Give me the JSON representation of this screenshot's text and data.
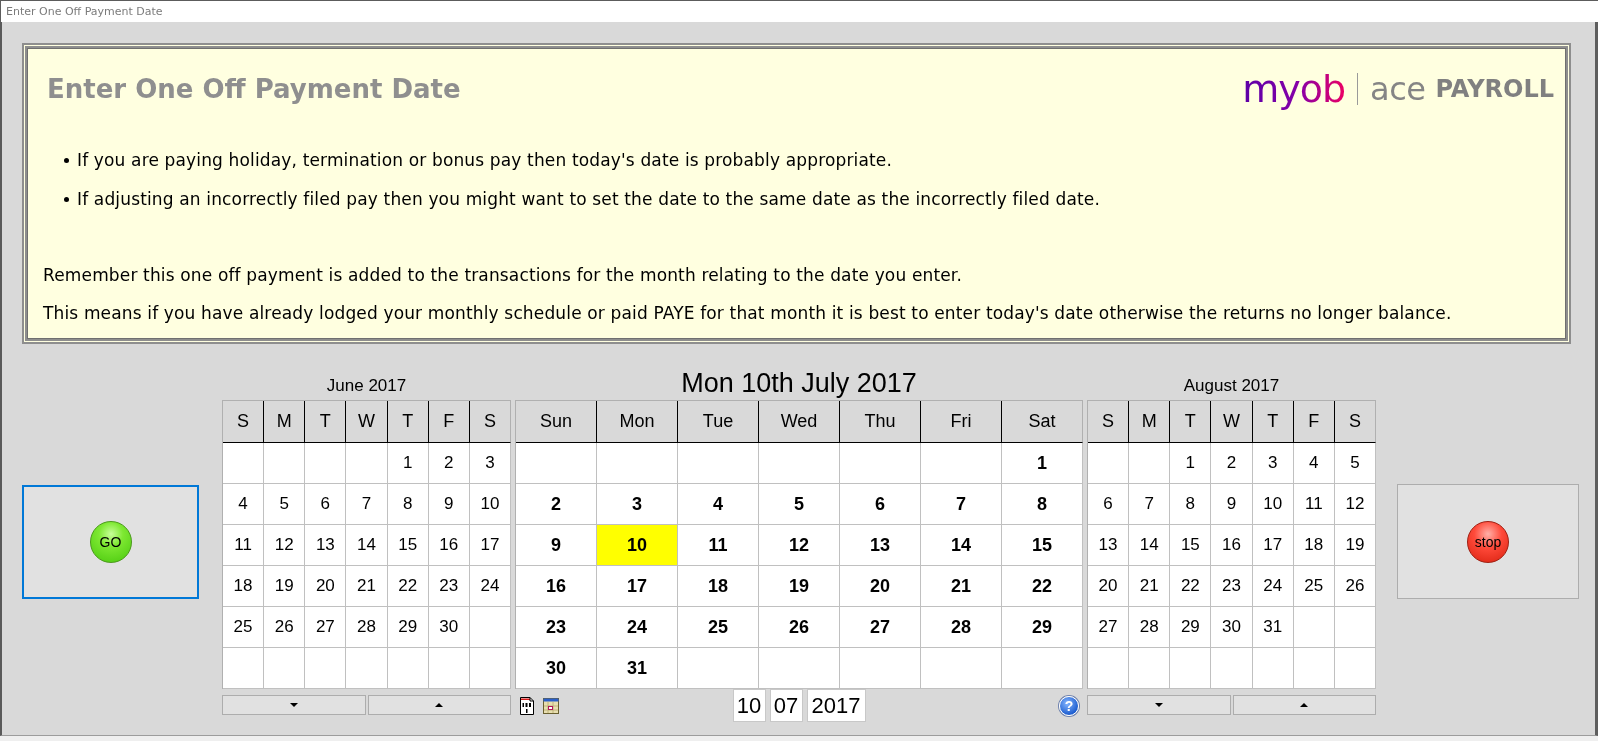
{
  "window": {
    "title": "Enter One Off Payment Date"
  },
  "info_panel": {
    "heading": "Enter One Off Payment Date",
    "logo": {
      "brand": "myob",
      "product": "ace",
      "edition": "PAYROLL"
    },
    "bullets": [
      "If you are paying holiday, termination or bonus pay then today's date is probably appropriate.",
      "If adjusting an incorrectly filed pay then you might want to set the date to the same date as the incorrectly filed date."
    ],
    "notes": [
      "Remember this one off payment is added to the transactions for the month relating to the date you enter.",
      "This means if you have already lodged your monthly schedule or paid PAYE for that month it is best to enter today's date otherwise the returns no longer balance."
    ]
  },
  "go_button": {
    "label": "GO",
    "focused": true
  },
  "calendars": [
    {
      "kind": "side",
      "title": "June 2017",
      "weekdays": [
        "S",
        "M",
        "T",
        "W",
        "T",
        "F",
        "S"
      ],
      "weeks": [
        {
          "thu": "1",
          "fri": "2",
          "sat": "3"
        },
        {
          "sun": "4",
          "mon": "5",
          "tue": "6",
          "wed": "7",
          "thu": "8",
          "fri": "9",
          "sat": "10"
        },
        {
          "sun": "11",
          "mon": "12",
          "tue": "13",
          "wed": "14",
          "thu": "15",
          "fri": "16",
          "sat": "17"
        },
        {
          "sun": "18",
          "mon": "19",
          "tue": "20",
          "wed": "21",
          "thu": "22",
          "fri": "23",
          "sat": "24"
        },
        {
          "sun": "25",
          "mon": "26",
          "tue": "27",
          "wed": "28",
          "thu": "29",
          "fri": "30"
        }
      ],
      "nav_buttons": [
        {
          "kind": "down"
        },
        {
          "kind": "up"
        }
      ]
    },
    {
      "kind": "main",
      "title": "Mon 10th July 2017",
      "weekdays": [
        "Sun",
        "Mon",
        "Tue",
        "Wed",
        "Thu",
        "Fri",
        "Sat"
      ],
      "weeks": [
        {
          "sat": {
            "day": "1",
            "selected": false
          }
        },
        {
          "sun": {
            "day": "2",
            "selected": false
          },
          "mon": {
            "day": "3",
            "selected": false
          },
          "tue": {
            "day": "4",
            "selected": false
          },
          "wed": {
            "day": "5",
            "selected": false
          },
          "thu": {
            "day": "6",
            "selected": false
          },
          "fri": {
            "day": "7",
            "selected": false
          },
          "sat": {
            "day": "8",
            "selected": false
          }
        },
        {
          "sun": {
            "day": "9",
            "selected": false
          },
          "mon": {
            "day": "10",
            "selected": true
          },
          "tue": {
            "day": "11",
            "selected": false
          },
          "wed": {
            "day": "12",
            "selected": false
          },
          "thu": {
            "day": "13",
            "selected": false
          },
          "fri": {
            "day": "14",
            "selected": false
          },
          "sat": {
            "day": "15",
            "selected": false
          }
        },
        {
          "sun": {
            "day": "16",
            "selected": false
          },
          "mon": {
            "day": "17",
            "selected": false
          },
          "tue": {
            "day": "18",
            "selected": false
          },
          "wed": {
            "day": "19",
            "selected": false
          },
          "thu": {
            "day": "20",
            "selected": false
          },
          "fri": {
            "day": "21",
            "selected": false
          },
          "sat": {
            "day": "22",
            "selected": false
          }
        },
        {
          "sun": {
            "day": "23",
            "selected": false
          },
          "mon": {
            "day": "24",
            "selected": false
          },
          "tue": {
            "day": "25",
            "selected": false
          },
          "wed": {
            "day": "26",
            "selected": false
          },
          "thu": {
            "day": "27",
            "selected": false
          },
          "fri": {
            "day": "28",
            "selected": false
          },
          "sat": {
            "day": "29",
            "selected": false
          }
        },
        {
          "sun": {
            "day": "30",
            "selected": false
          },
          "mon": {
            "day": "31",
            "selected": false
          }
        }
      ],
      "date_entry": {
        "day": "10",
        "month": "07",
        "year": "2017"
      },
      "help_button": {
        "label": "?"
      }
    },
    {
      "kind": "side",
      "title": "August 2017",
      "weekdays": [
        "S",
        "M",
        "T",
        "W",
        "T",
        "F",
        "S"
      ],
      "weeks": [
        {
          "tue": "1",
          "wed": "2",
          "thu": "3",
          "fri": "4",
          "sat": "5"
        },
        {
          "sun": "6",
          "mon": "7",
          "tue": "8",
          "wed": "9",
          "thu": "10",
          "fri": "11",
          "sat": "12"
        },
        {
          "sun": "13",
          "mon": "14",
          "tue": "15",
          "wed": "16",
          "thu": "17",
          "fri": "18",
          "sat": "19"
        },
        {
          "sun": "20",
          "mon": "21",
          "tue": "22",
          "wed": "23",
          "thu": "24",
          "fri": "25",
          "sat": "26"
        },
        {
          "sun": "27",
          "mon": "28",
          "tue": "29",
          "wed": "30",
          "thu": "31"
        }
      ],
      "nav_buttons": [
        {
          "kind": "down"
        },
        {
          "kind": "up"
        }
      ]
    }
  ],
  "stop_button": {
    "label": "stop",
    "focused": false
  }
}
